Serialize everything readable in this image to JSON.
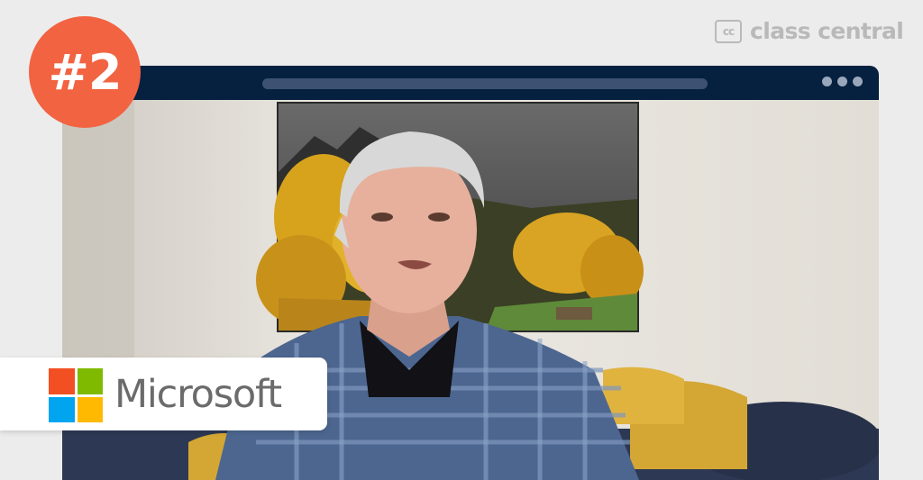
{
  "brand": {
    "logo_text": "cc",
    "name": "class central"
  },
  "rank_badge": {
    "label": "#2",
    "color": "#f26341"
  },
  "provider": {
    "name": "Microsoft",
    "logo_colors": [
      "#f25022",
      "#7fba00",
      "#00a4ef",
      "#ffb900"
    ]
  },
  "browser": {
    "frame_color": "#06203f"
  }
}
